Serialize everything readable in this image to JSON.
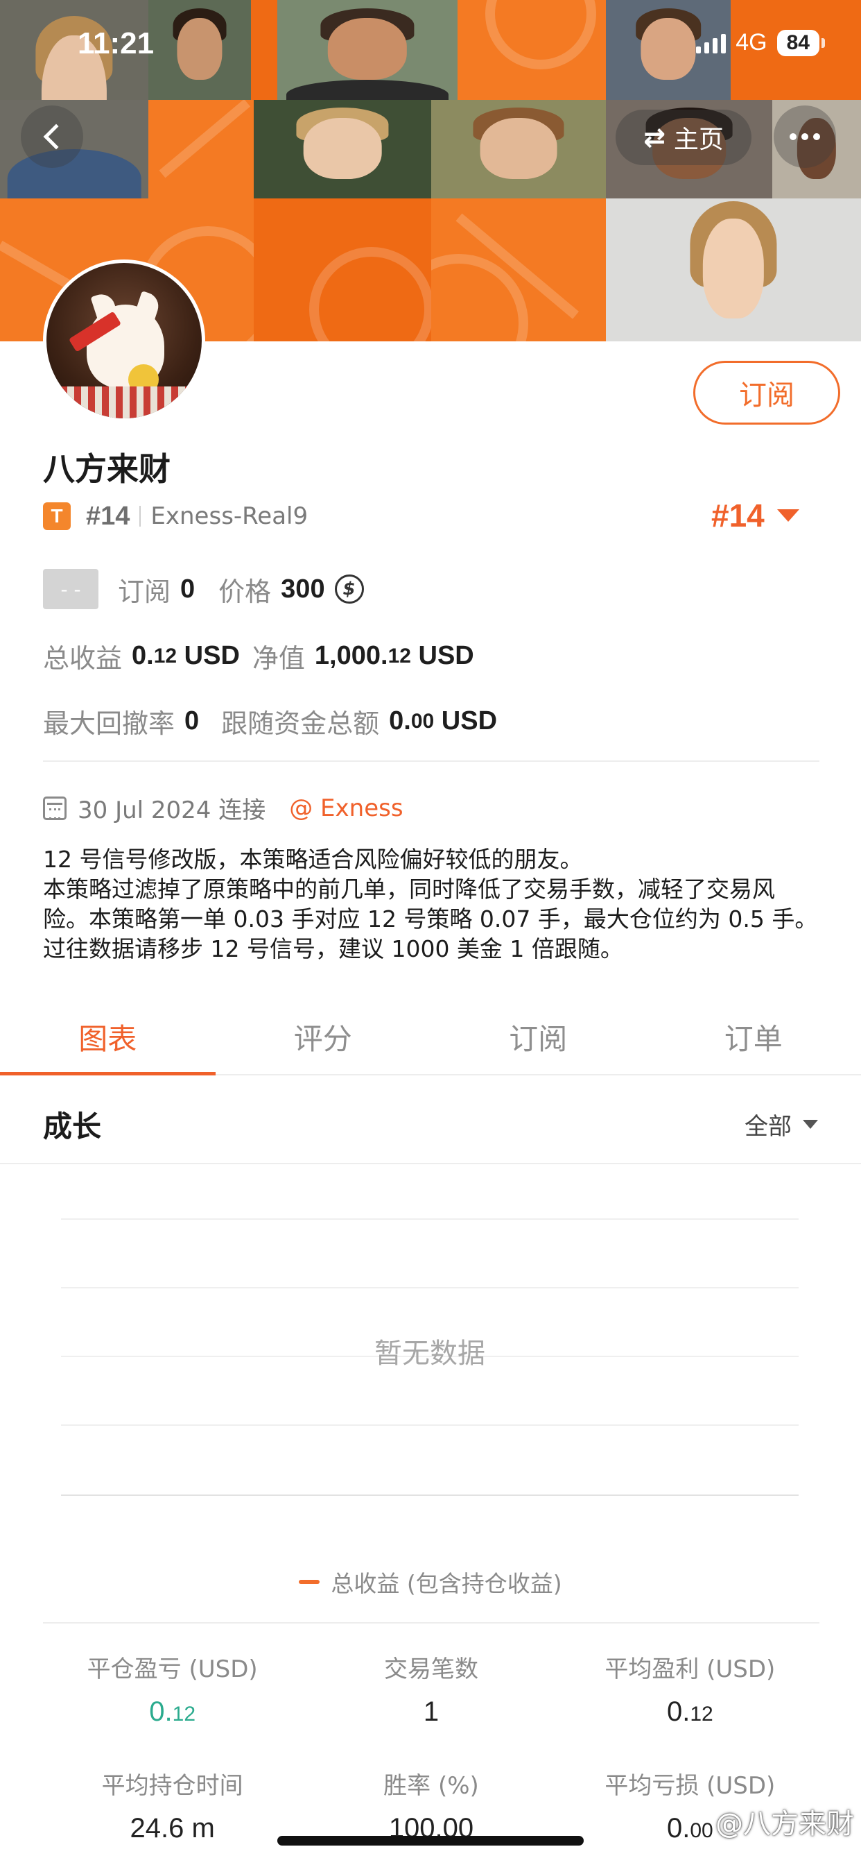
{
  "status_bar": {
    "time": "11:21",
    "network": "4G",
    "battery": "84"
  },
  "header": {
    "home_label": "主页",
    "swap_icon": "⇄"
  },
  "profile": {
    "subscribe_label": "订阅",
    "name": "八方来财",
    "badge": "T",
    "rank_small": "#14",
    "server": "Exness-Real9",
    "rank_big": "#14"
  },
  "stats_top": {
    "placeholder": "- -",
    "subscribe_label": "订阅",
    "subscribe_count": "0",
    "price_label": "价格",
    "price_value": "300",
    "coin_symbol": "$"
  },
  "income": {
    "total_label": "总收益",
    "total_int": "0.",
    "total_dec": "12",
    "total_unit": " USD",
    "equity_label": "净值",
    "equity_int": "1,000.",
    "equity_dec": "12",
    "equity_unit": " USD"
  },
  "drawdown": {
    "label": "最大回撤率",
    "value": "0",
    "follow_label": "跟随资金总额",
    "follow_int": "0.",
    "follow_dec": "00",
    "follow_unit": " USD"
  },
  "connect": {
    "date": "30 Jul 2024 连接",
    "broker": "@ Exness"
  },
  "description": [
    "12 号信号修改版，本策略适合风险偏好较低的朋友。",
    "本策略过滤掉了原策略中的前几单，同时降低了交易手数，减轻了交易风险。本策略第一单 0.03 手对应 12 号策略 0.07 手，最大仓位约为 0.5 手。",
    "过往数据请移步 12 号信号，建议 1000 美金 1 倍跟随。"
  ],
  "tabs": [
    "图表",
    "评分",
    "订阅",
    "订单"
  ],
  "section": {
    "title": "成长",
    "filter": "全部"
  },
  "chart_placeholder": "暂无数据",
  "legend": "总收益 (包含持仓收益)",
  "stats": [
    {
      "label": "平仓盈亏 (USD)",
      "int": "0.",
      "dec": "12"
    },
    {
      "label": "交易笔数",
      "int": "1",
      "dec": ""
    },
    {
      "label": "平均盈利 (USD)",
      "int": "0.",
      "dec": "12"
    },
    {
      "label": "平均持仓时间",
      "int": "24.6 m",
      "dec": ""
    },
    {
      "label": "胜率 (%)",
      "int": "100.00",
      "dec": ""
    },
    {
      "label": "平均亏损 (USD)",
      "int": "0.",
      "dec": "00"
    }
  ],
  "watermark": "@八方来财",
  "colors": {
    "accent": "#f0612b",
    "profit_green": "#2bab8e",
    "banner_orange": "#f26d1a"
  },
  "icons": [
    "back-arrow-icon",
    "swap-icon",
    "more-icon",
    "dropdown-triangle-icon",
    "coin-icon",
    "calendar-icon"
  ]
}
